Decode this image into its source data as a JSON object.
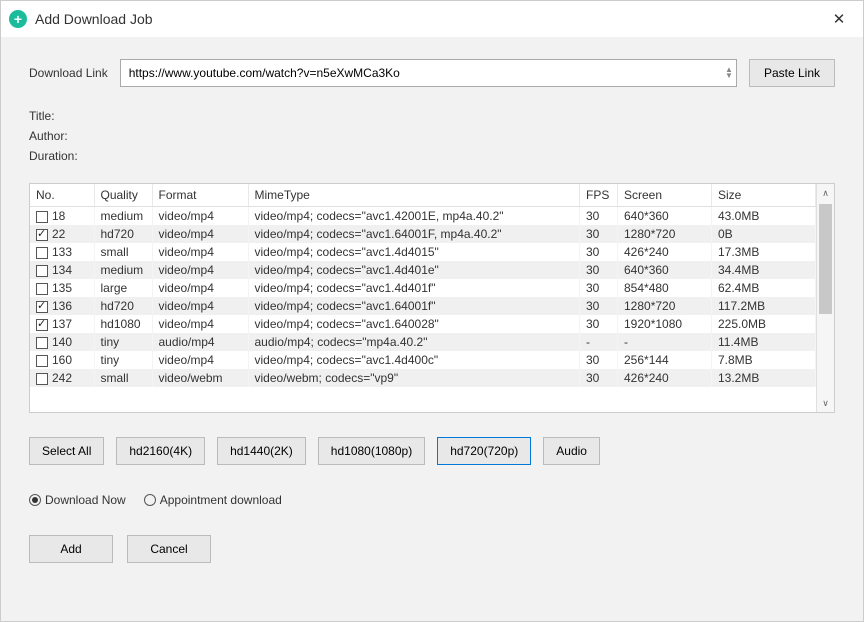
{
  "window": {
    "title": "Add Download Job",
    "close": "✕"
  },
  "link": {
    "label": "Download Link",
    "value": "https://www.youtube.com/watch?v=n5eXwMCa3Ko",
    "paste_btn": "Paste Link"
  },
  "meta": {
    "title_label": "Title:",
    "author_label": "Author:",
    "duration_label": "Duration:"
  },
  "table": {
    "headers": {
      "no": "No.",
      "quality": "Quality",
      "format": "Format",
      "mime": "MimeType",
      "fps": "FPS",
      "screen": "Screen",
      "size": "Size"
    },
    "rows": [
      {
        "checked": false,
        "no": "18",
        "quality": "medium",
        "format": "video/mp4",
        "mime": "video/mp4; codecs=\"avc1.42001E, mp4a.40.2\"",
        "fps": "30",
        "screen": "640*360",
        "size": "43.0MB"
      },
      {
        "checked": true,
        "no": "22",
        "quality": "hd720",
        "format": "video/mp4",
        "mime": "video/mp4; codecs=\"avc1.64001F, mp4a.40.2\"",
        "fps": "30",
        "screen": "1280*720",
        "size": "0B"
      },
      {
        "checked": false,
        "no": "133",
        "quality": "small",
        "format": "video/mp4",
        "mime": "video/mp4; codecs=\"avc1.4d4015\"",
        "fps": "30",
        "screen": "426*240",
        "size": "17.3MB"
      },
      {
        "checked": false,
        "no": "134",
        "quality": "medium",
        "format": "video/mp4",
        "mime": "video/mp4; codecs=\"avc1.4d401e\"",
        "fps": "30",
        "screen": "640*360",
        "size": "34.4MB"
      },
      {
        "checked": false,
        "no": "135",
        "quality": "large",
        "format": "video/mp4",
        "mime": "video/mp4; codecs=\"avc1.4d401f\"",
        "fps": "30",
        "screen": "854*480",
        "size": "62.4MB"
      },
      {
        "checked": true,
        "no": "136",
        "quality": "hd720",
        "format": "video/mp4",
        "mime": "video/mp4; codecs=\"avc1.64001f\"",
        "fps": "30",
        "screen": "1280*720",
        "size": "117.2MB"
      },
      {
        "checked": true,
        "no": "137",
        "quality": "hd1080",
        "format": "video/mp4",
        "mime": "video/mp4; codecs=\"avc1.640028\"",
        "fps": "30",
        "screen": "1920*1080",
        "size": "225.0MB"
      },
      {
        "checked": false,
        "no": "140",
        "quality": "tiny",
        "format": "audio/mp4",
        "mime": "audio/mp4; codecs=\"mp4a.40.2\"",
        "fps": "-",
        "screen": "-",
        "size": "11.4MB"
      },
      {
        "checked": false,
        "no": "160",
        "quality": "tiny",
        "format": "video/mp4",
        "mime": "video/mp4; codecs=\"avc1.4d400c\"",
        "fps": "30",
        "screen": "256*144",
        "size": "7.8MB"
      },
      {
        "checked": false,
        "no": "242",
        "quality": "small",
        "format": "video/webm",
        "mime": "video/webm; codecs=\"vp9\"",
        "fps": "30",
        "screen": "426*240",
        "size": "13.2MB"
      }
    ]
  },
  "presets": {
    "select_all": "Select All",
    "hd2160": "hd2160(4K)",
    "hd1440": "hd1440(2K)",
    "hd1080": "hd1080(1080p)",
    "hd720": "hd720(720p)",
    "audio": "Audio"
  },
  "radios": {
    "download_now": "Download Now",
    "appointment": "Appointment download"
  },
  "actions": {
    "add": "Add",
    "cancel": "Cancel"
  }
}
